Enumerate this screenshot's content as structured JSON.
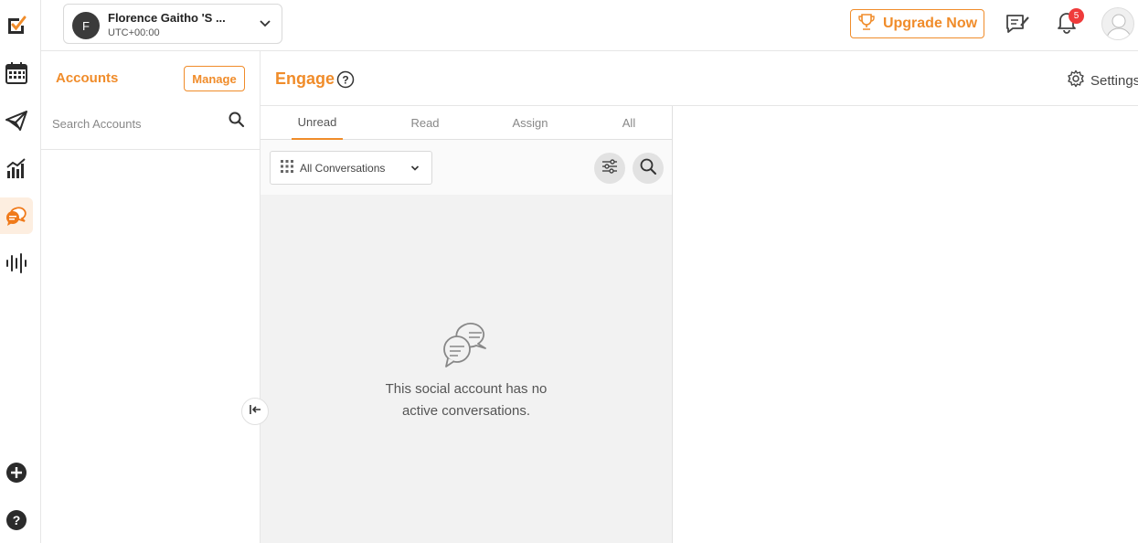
{
  "rail": {
    "icons": [
      "app-logo-icon",
      "calendar-icon",
      "publish-icon",
      "analytics-icon",
      "engage-icon",
      "listening-icon",
      "add-icon",
      "help-icon"
    ]
  },
  "workspace": {
    "initial": "F",
    "name": "Florence Gaitho 'S ...",
    "timezone": "UTC+00:00"
  },
  "topbar": {
    "upgrade_label": "Upgrade Now",
    "notification_count": "5"
  },
  "accounts": {
    "title": "Accounts",
    "manage_label": "Manage",
    "search_placeholder": "Search Accounts"
  },
  "engage": {
    "title": "Engage",
    "settings_label": "Settings",
    "tabs": [
      {
        "label": "Unread",
        "active": true
      },
      {
        "label": "Read",
        "active": false
      },
      {
        "label": "Assign",
        "active": false
      },
      {
        "label": "All",
        "active": false
      }
    ],
    "conversation_filter": "All Conversations",
    "empty_line1": "This social account has no",
    "empty_line2": "active conversations."
  },
  "colors": {
    "accent": "#f08c2a",
    "badge": "#ef3b3b"
  }
}
